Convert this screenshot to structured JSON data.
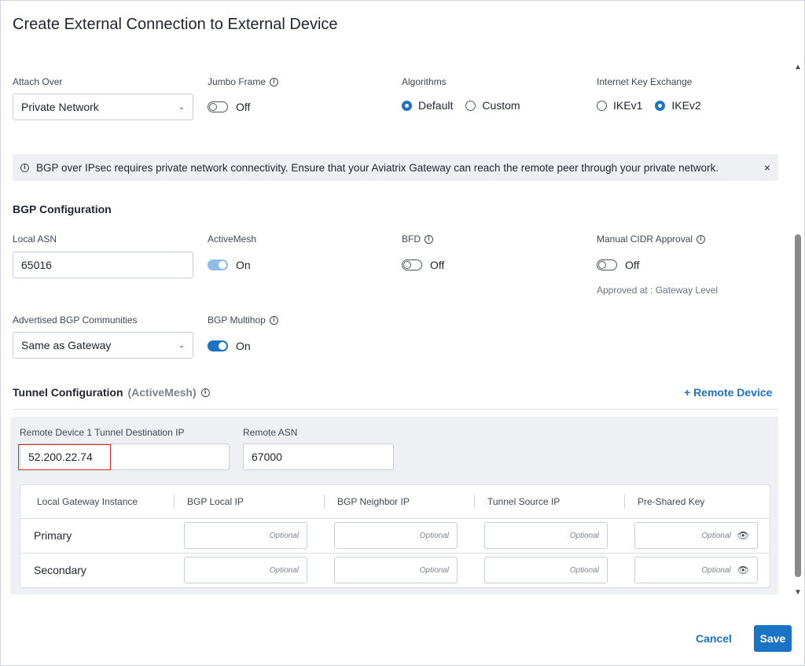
{
  "modal": {
    "title": "Create External Connection to External Device"
  },
  "connection": {
    "attach_over": {
      "label": "Attach Over",
      "value": "Private Network"
    },
    "jumbo_frame": {
      "label": "Jumbo Frame",
      "state": "Off"
    },
    "algorithms": {
      "label": "Algorithms",
      "options": [
        "Default",
        "Custom"
      ],
      "selected": "Default"
    },
    "ike": {
      "label": "Internet Key Exchange",
      "options": [
        "IKEv1",
        "IKEv2"
      ],
      "selected": "IKEv2"
    }
  },
  "alert": {
    "message": "BGP over IPsec requires private network connectivity. Ensure that your Aviatrix Gateway can reach the remote peer through your private network.",
    "close": "×"
  },
  "bgp": {
    "title": "BGP Configuration",
    "local_asn": {
      "label": "Local ASN",
      "value": "65016"
    },
    "activemesh": {
      "label": "ActiveMesh",
      "state": "On"
    },
    "bfd": {
      "label": "BFD",
      "state": "Off"
    },
    "manual_cidr": {
      "label": "Manual CIDR Approval",
      "state": "Off",
      "note": "Approved at : Gateway Level"
    },
    "communities": {
      "label": "Advertised BGP Communities",
      "value": "Same as Gateway"
    },
    "multihop": {
      "label": "BGP Multihop",
      "state": "On"
    }
  },
  "tunnel": {
    "title": "Tunnel Configuration",
    "subtitle": "(ActiveMesh)",
    "add_remote_label": "+ Remote Device",
    "remote_ip": {
      "label": "Remote Device 1 Tunnel Destination IP",
      "value": "52.200.22.74"
    },
    "remote_asn": {
      "label": "Remote ASN",
      "value": "67000"
    },
    "table": {
      "headers": [
        "Local Gateway Instance",
        "BGP Local IP",
        "BGP Neighbor IP",
        "Tunnel Source IP",
        "Pre-Shared Key"
      ],
      "rows": [
        {
          "name": "Primary",
          "placeholders": [
            "Optional",
            "Optional",
            "Optional",
            "Optional"
          ]
        },
        {
          "name": "Secondary",
          "placeholders": [
            "Optional",
            "Optional",
            "Optional",
            "Optional"
          ]
        }
      ]
    }
  },
  "footer": {
    "cancel": "Cancel",
    "save": "Save"
  },
  "colors": {
    "accent": "#1a73c4",
    "highlight": "#d92a2a",
    "panel": "#eef0f3"
  }
}
